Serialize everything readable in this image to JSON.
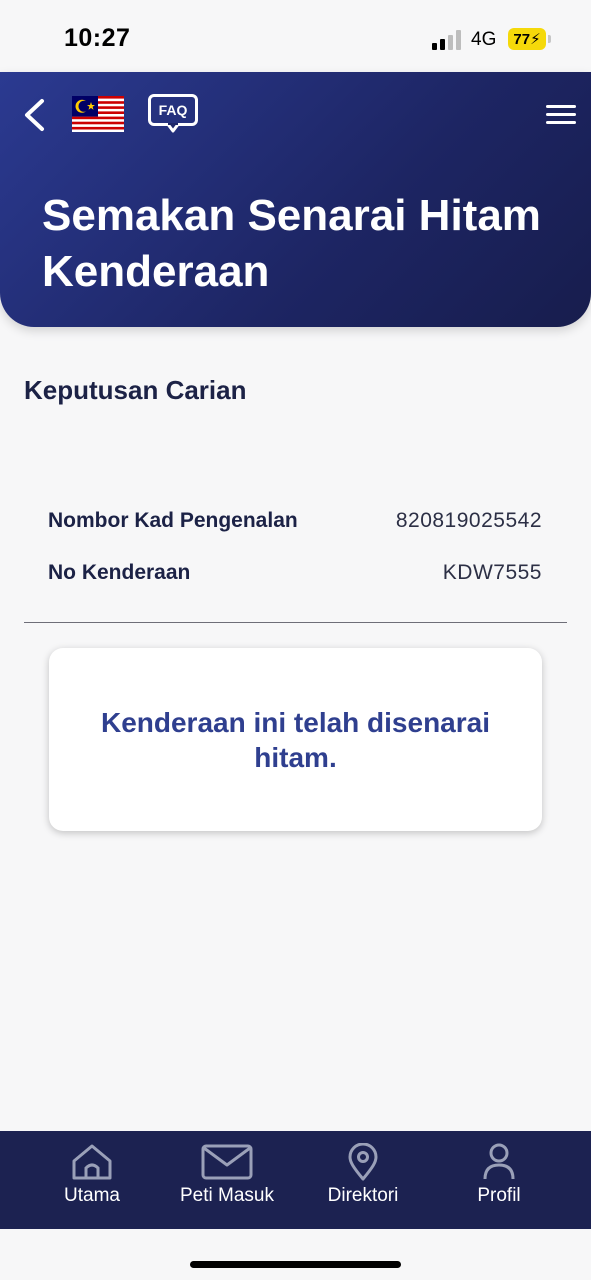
{
  "status_bar": {
    "time": "10:27",
    "network": "4G",
    "battery": "77",
    "battery_color": "#f5d90a"
  },
  "header": {
    "title": "Semakan Senarai Hitam Kenderaan",
    "faq_label": "FAQ",
    "gradient_start": "#2b3a91",
    "gradient_end": "#171d4d"
  },
  "main": {
    "section_heading": "Keputusan Carian",
    "details": [
      {
        "label": "Nombor Kad Pengenalan",
        "value": "820819025542"
      },
      {
        "label": "No Kenderaan",
        "value": "KDW7555"
      }
    ],
    "result_message": "Kenderaan ini telah disenarai hitam.",
    "result_color": "#2f3f8f"
  },
  "bottom_nav": {
    "items": [
      {
        "label": "Utama",
        "icon": "home-icon"
      },
      {
        "label": "Peti Masuk",
        "icon": "mail-icon"
      },
      {
        "label": "Direktori",
        "icon": "location-pin-icon"
      },
      {
        "label": "Profil",
        "icon": "person-icon"
      }
    ],
    "background": "#1c2251"
  }
}
